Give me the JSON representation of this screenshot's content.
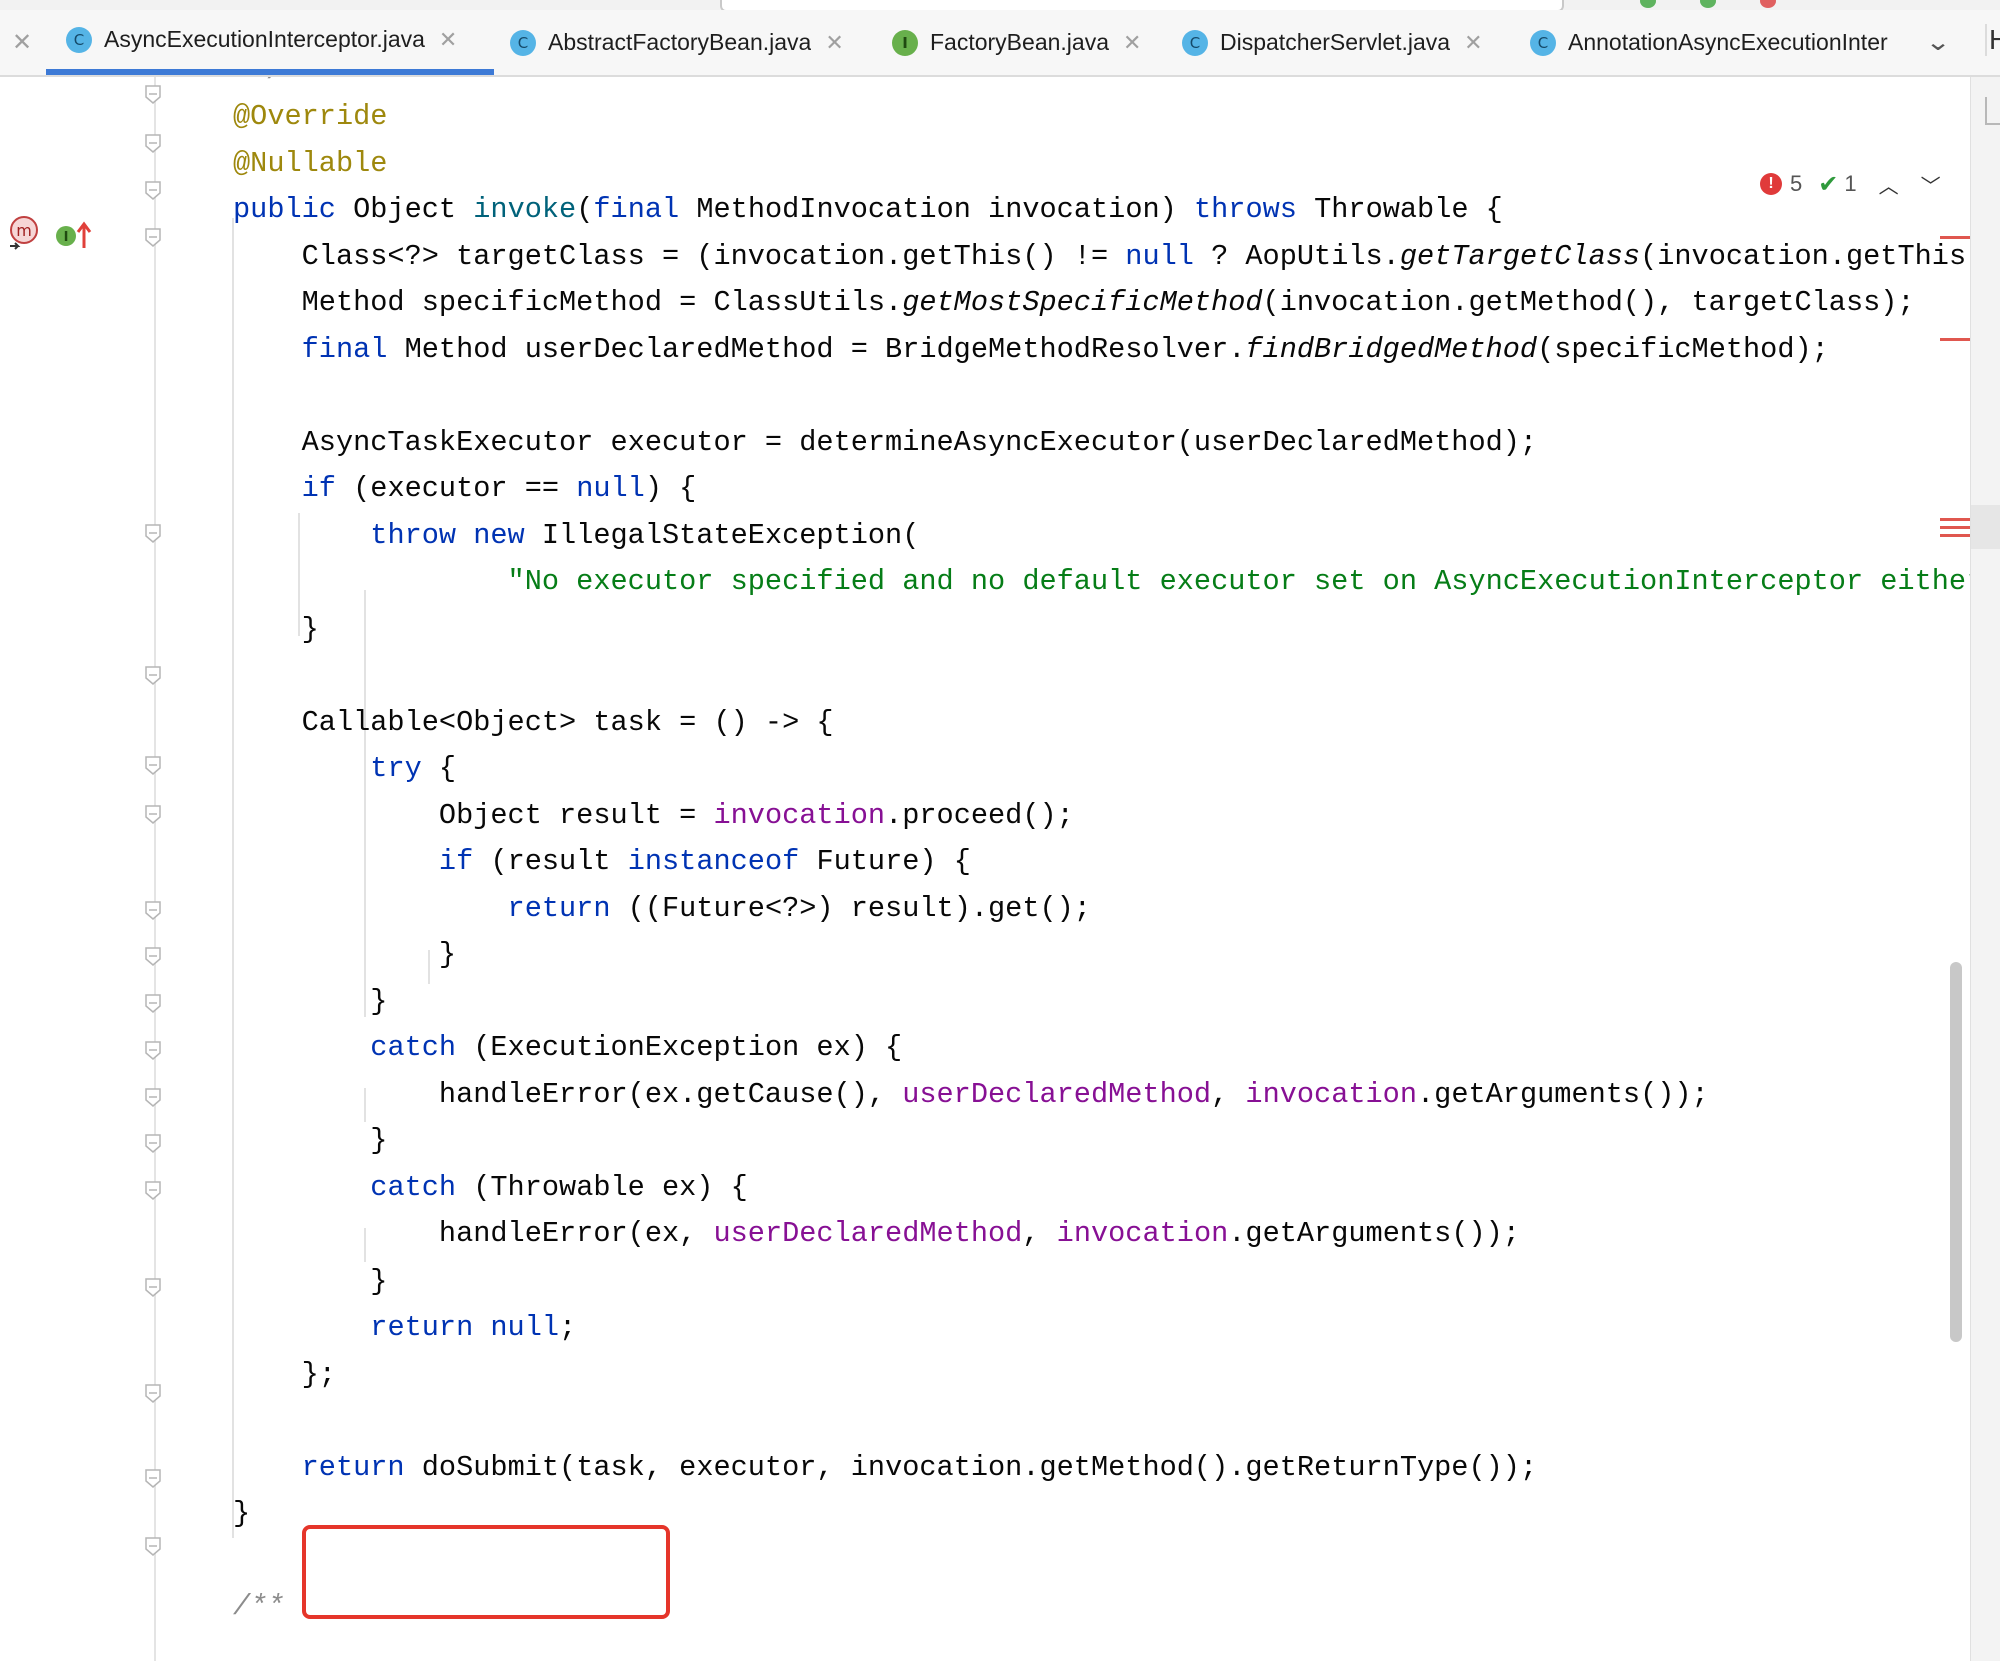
{
  "tabs": [
    {
      "label": "AsyncExecutionInterceptor.java",
      "icon": "class-c-icon",
      "active": true
    },
    {
      "label": "AbstractFactoryBean.java",
      "icon": "class-c-icon",
      "active": false
    },
    {
      "label": "FactoryBean.java",
      "icon": "interface-i-icon",
      "active": false
    },
    {
      "label": "DispatcherServlet.java",
      "icon": "class-c-icon",
      "active": false
    },
    {
      "label": "AnnotationAsyncExecutionInter",
      "icon": "class-c-icon",
      "active": false
    }
  ],
  "tab_close_glyph": "✕",
  "tab_icon_letters": {
    "class": "C",
    "interface": "I"
  },
  "right_panel_letter": "H",
  "inspections": {
    "errors": "5",
    "warnings_ok": "1"
  },
  "code_lines": [
    "<span class=\"cmt\"> */</span>",
    "<span class=\"ann\">@Override</span>",
    "<span class=\"ann\">@Nullable</span>",
    "<span class=\"kw\">public</span> Object <span style=\"color:#00627a\">invoke</span>(<span class=\"kw\">final</span> MethodInvocation invocation) <span class=\"kw\">throws</span> Throwable {",
    "    Class&lt;?&gt; targetClass = (invocation.getThis() != <span class=\"kw\">null</span> ? AopUtils.<span class=\"itl\">getTargetClass</span>(invocation.getThis())",
    "    Method specificMethod = ClassUtils.<span class=\"itl\">getMostSpecificMethod</span>(invocation.getMethod(), targetClass);",
    "    <span class=\"kw\">final</span> Method userDeclaredMethod = BridgeMethodResolver.<span class=\"itl\">findBridgedMethod</span>(specificMethod);",
    "",
    "    AsyncTaskExecutor executor = determineAsyncExecutor(userDeclaredMethod);",
    "    <span class=\"kw\">if</span> (executor == <span class=\"kw\">null</span>) {",
    "        <span class=\"kw\">throw new</span> IllegalStateException(",
    "                <span class=\"str\">\"No executor specified and no default executor set on AsyncExecutionInterceptor either\"</span>);",
    "    }",
    "",
    "    Callable&lt;Object&gt; task = () -&gt; {",
    "        <span class=\"kw\">try</span> {",
    "            Object result = <span class=\"fld\">invocation</span>.proceed();",
    "            <span class=\"kw\">if</span> (result <span class=\"kw\">instanceof</span> Future) {",
    "                <span class=\"kw\">return</span> ((Future&lt;?&gt;) result).get();",
    "            }",
    "        }",
    "        <span class=\"kw\">catch</span> (ExecutionException ex) {",
    "            handleError(ex.getCause(), <span class=\"fld\">userDeclaredMethod</span>, <span class=\"fld\">invocation</span>.getArguments());",
    "        }",
    "        <span class=\"kw\">catch</span> (Throwable ex) {",
    "            handleError(ex, <span class=\"fld\">userDeclaredMethod</span>, <span class=\"fld\">invocation</span>.getArguments());",
    "        }",
    "        <span class=\"kw\">return null</span>;",
    "    };",
    "",
    "    <span class=\"kw\">return</span> doSubmit(task, executor, invocation.getMethod().getReturnType());",
    "}",
    "",
    "<span class=\"cmt\">/**</span>"
  ],
  "colors": {
    "keyword": "#0033b3",
    "annotation": "#9e880d",
    "string": "#067d17",
    "field": "#871094",
    "highlight_box": "#e5352a",
    "active_tab_underline": "#3d7ad6"
  }
}
